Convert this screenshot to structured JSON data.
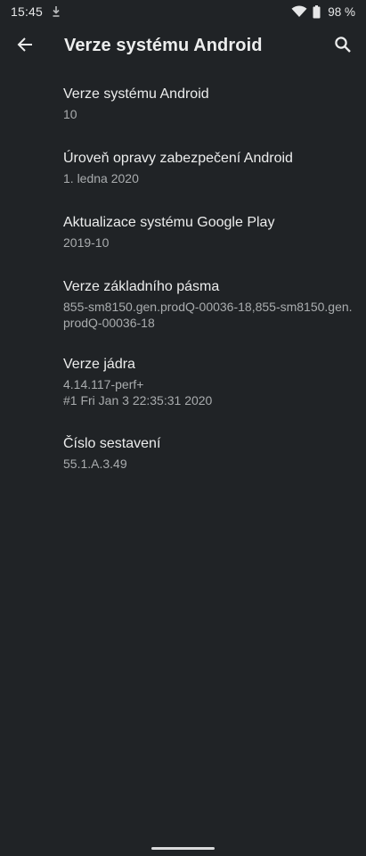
{
  "status_bar": {
    "time": "15:45",
    "battery_text": "98 %",
    "icons": [
      "download-icon",
      "wifi-icon",
      "battery-icon"
    ]
  },
  "app_bar": {
    "title": "Verze systému Android",
    "icons": [
      "back-arrow-icon",
      "search-icon"
    ]
  },
  "items": [
    {
      "title": "Verze systému Android",
      "value_lines": [
        "10"
      ]
    },
    {
      "title": "Úroveň opravy zabezpečení Android",
      "value_lines": [
        "1. ledna 2020"
      ]
    },
    {
      "title": "Aktualizace systému Google Play",
      "value_lines": [
        "2019-10"
      ]
    },
    {
      "title": "Verze základního pásma",
      "value_lines": [
        "855-sm8150.gen.prodQ-00036-18,855-sm8150.gen.",
        "prodQ-00036-18"
      ]
    },
    {
      "title": "Verze jádra",
      "value_lines": [
        "4.14.117-perf+",
        "#1 Fri Jan 3 22:35:31 2020"
      ]
    },
    {
      "title": "Číslo sestavení",
      "value_lines": [
        "55.1.A.3.49"
      ]
    }
  ],
  "colors": {
    "background": "#202326",
    "primary_text": "#eceded",
    "secondary_text": "#a9acae"
  }
}
